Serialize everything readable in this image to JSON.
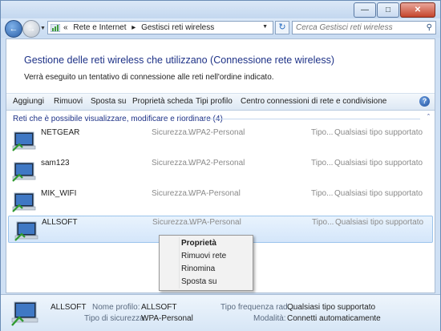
{
  "window": {
    "minimize_icon": "minimize-icon",
    "maximize_icon": "maximize-icon",
    "close_icon": "close-icon"
  },
  "addressbar": {
    "overflow": "«",
    "breadcrumbs": [
      "Rete e Internet",
      "Gestisci reti wireless"
    ],
    "separator": "▸",
    "search_placeholder": "Cerca Gestisci reti wireless"
  },
  "header": {
    "title": "Gestione delle reti wireless che utilizzano (Connessione rete wireless)",
    "subtitle": "Verrà eseguito un tentativo di connessione alle reti nell'ordine indicato."
  },
  "toolbar": {
    "items": [
      "Aggiungi",
      "Rimuovi",
      "Sposta su",
      "Proprietà scheda",
      "Tipi profilo",
      "Centro connessioni di rete e condivisione"
    ],
    "help": "?"
  },
  "group": {
    "title": "Reti che è possibile visualizzare, modificare e riordinare (4)"
  },
  "networks": [
    {
      "name": "NETGEAR",
      "security_label": "Sicurezza...",
      "security": "WPA2-Personal",
      "type_label": "Tipo...",
      "type": "Qualsiasi tipo supportato"
    },
    {
      "name": "sam123",
      "security_label": "Sicurezza...",
      "security": "WPA2-Personal",
      "type_label": "Tipo...",
      "type": "Qualsiasi tipo supportato"
    },
    {
      "name": "MIK_WIFI",
      "security_label": "Sicurezza...",
      "security": "WPA-Personal",
      "type_label": "Tipo...",
      "type": "Qualsiasi tipo supportato"
    },
    {
      "name": "ALLSOFT",
      "security_label": "Sicurezza...",
      "security": "WPA-Personal",
      "type_label": "Tipo...",
      "type": "Qualsiasi tipo supportato"
    }
  ],
  "context_menu": {
    "items": [
      "Proprietà",
      "Rimuovi rete",
      "Rinomina",
      "Sposta su"
    ]
  },
  "details": {
    "name": "ALLSOFT",
    "profile_label": "Nome profilo:",
    "profile_value": "ALLSOFT",
    "security_label": "Tipo di sicurezza:",
    "security_value": "WPA-Personal",
    "freq_label": "Tipo frequenza rad...",
    "freq_value": "Qualsiasi tipo supportato",
    "mode_label": "Modalità:",
    "mode_value": "Connetti automaticamente"
  },
  "colors": {
    "title_blue": "#1e3287",
    "selection": "#d4e6fa"
  }
}
